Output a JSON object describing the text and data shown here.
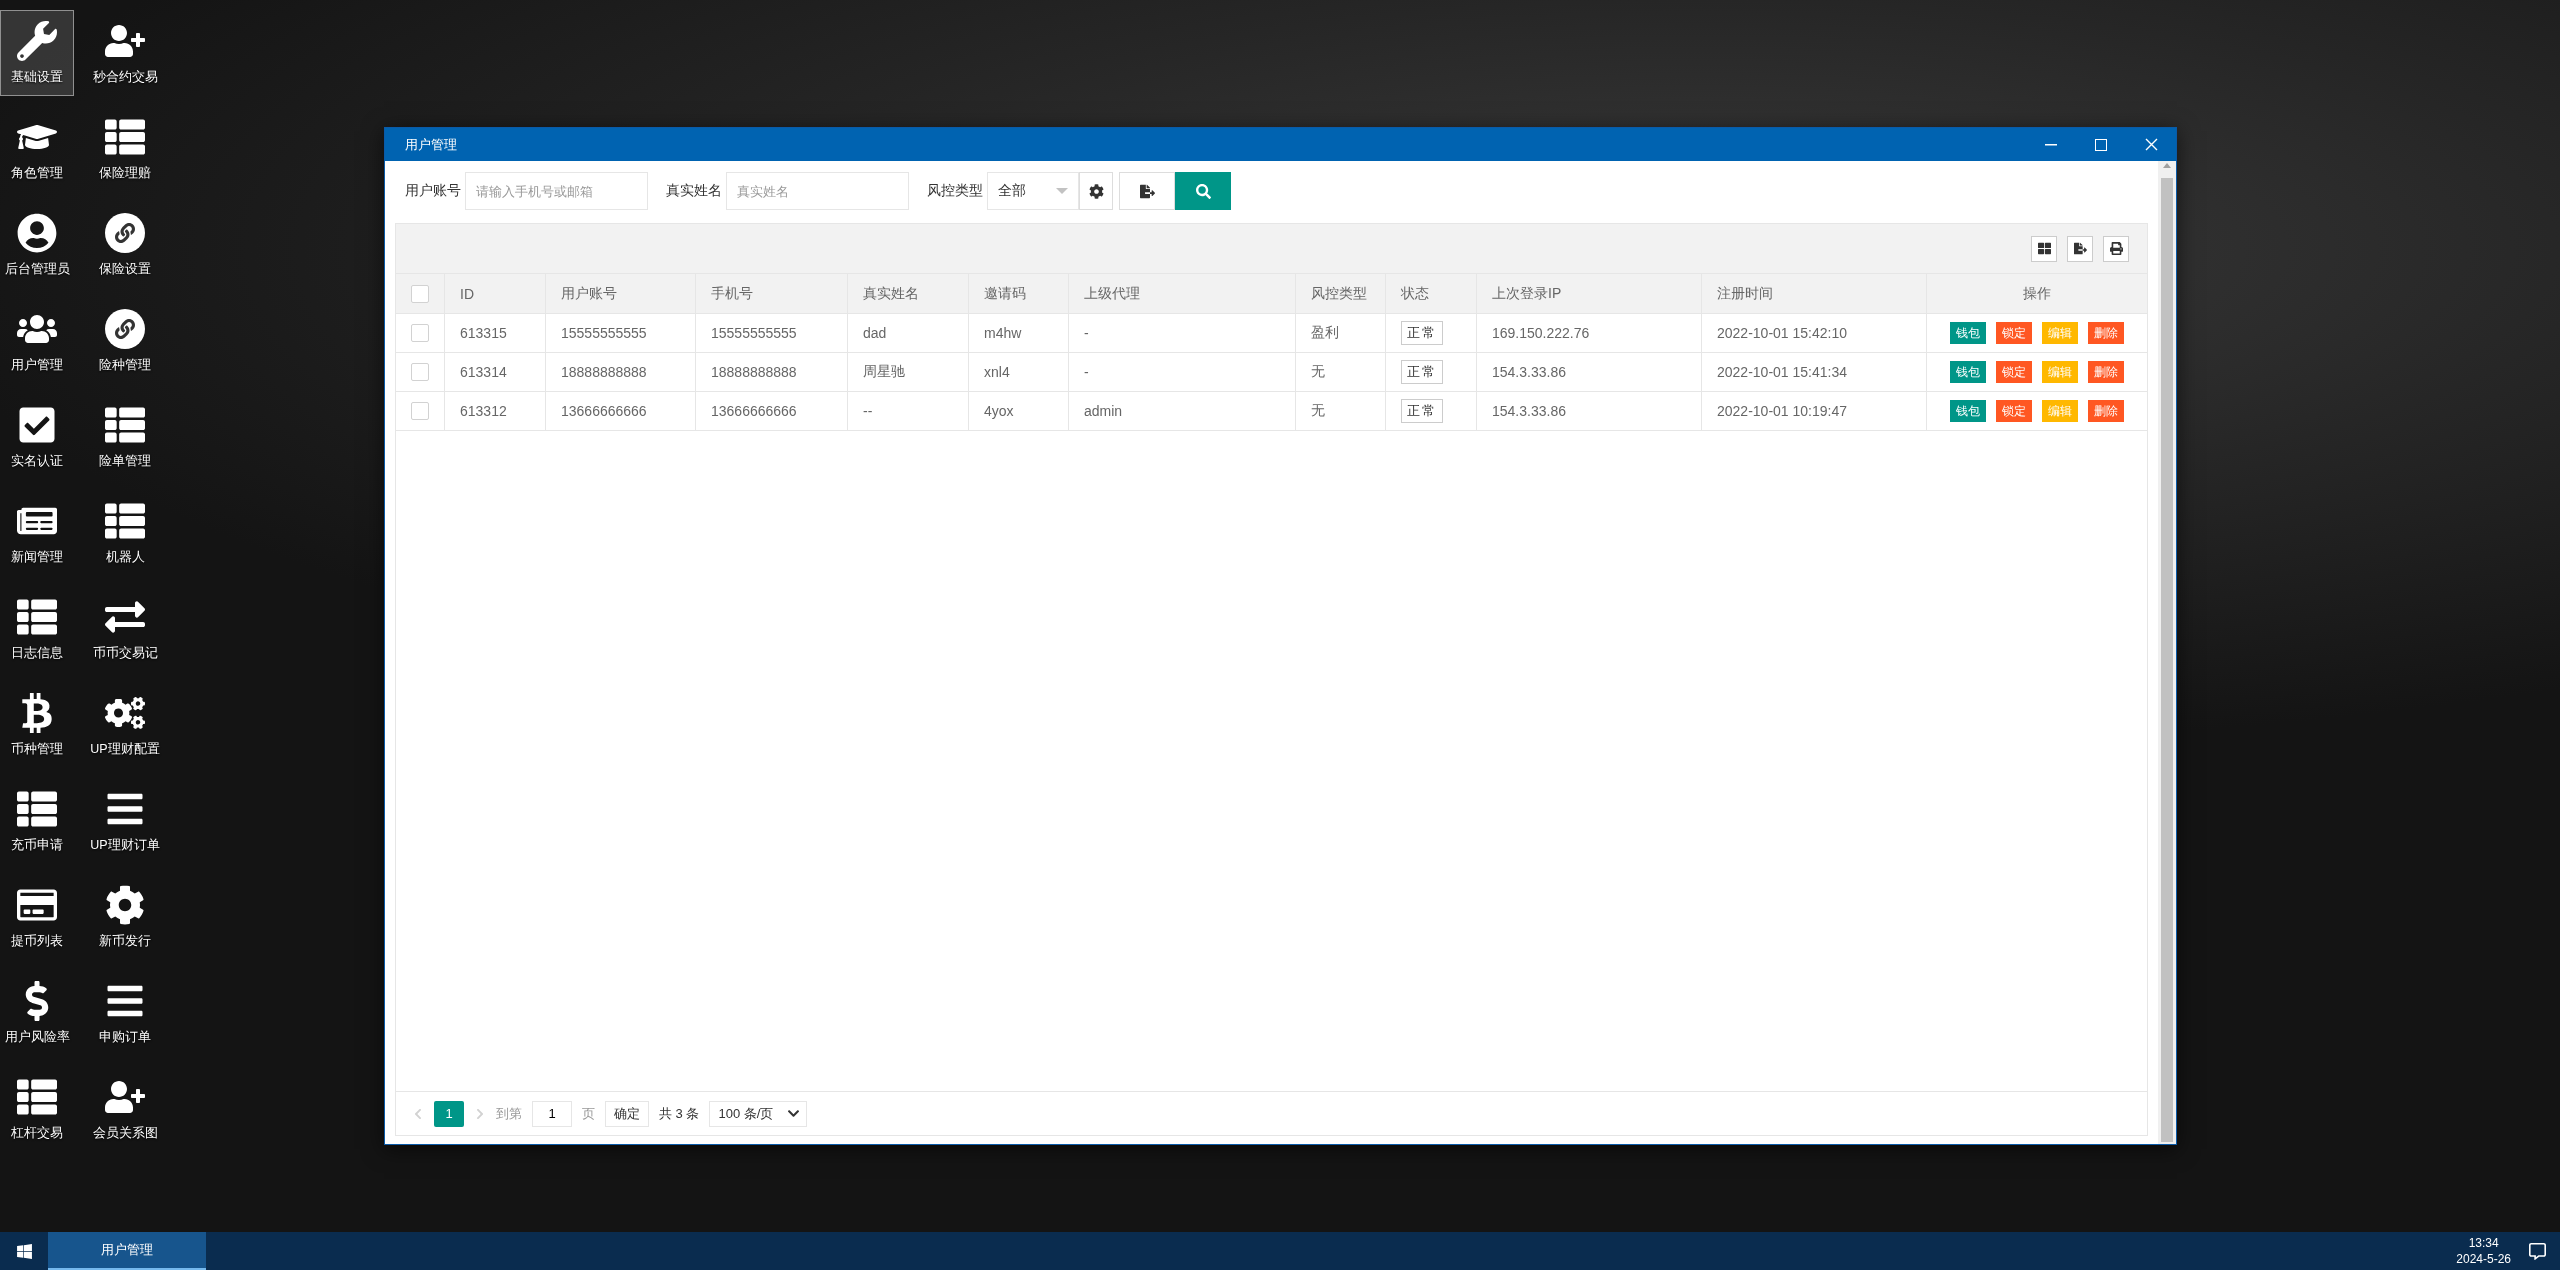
{
  "desktop_icons": [
    {
      "label": "基础设置",
      "selected": true
    },
    {
      "label": "秒合约交易",
      "selected": false
    },
    {
      "label": "角色管理",
      "selected": false
    },
    {
      "label": "保险理赔",
      "selected": false
    },
    {
      "label": "后台管理员",
      "selected": false
    },
    {
      "label": "保险设置",
      "selected": false
    },
    {
      "label": "用户管理",
      "selected": false
    },
    {
      "label": "险种管理",
      "selected": false
    },
    {
      "label": "实名认证",
      "selected": false
    },
    {
      "label": "险单管理",
      "selected": false
    },
    {
      "label": "新闻管理",
      "selected": false
    },
    {
      "label": "机器人",
      "selected": false
    },
    {
      "label": "日志信息",
      "selected": false
    },
    {
      "label": "币币交易记",
      "selected": false
    },
    {
      "label": "币种管理",
      "selected": false
    },
    {
      "label": "UP理财配置",
      "selected": false
    },
    {
      "label": "充币申请",
      "selected": false
    },
    {
      "label": "UP理财订单",
      "selected": false
    },
    {
      "label": "提币列表",
      "selected": false
    },
    {
      "label": "新币发行",
      "selected": false
    },
    {
      "label": "用户风险率",
      "selected": false
    },
    {
      "label": "申购订单",
      "selected": false
    },
    {
      "label": "杠杆交易",
      "selected": false
    },
    {
      "label": "会员关系图",
      "selected": false
    }
  ],
  "window": {
    "title": "用户管理"
  },
  "filters": [
    {
      "label": "用户账号",
      "placeholder": "请输入手机号或邮箱"
    },
    {
      "label": "真实姓名",
      "placeholder": "真实姓名"
    }
  ],
  "risk_select": {
    "label": "风控类型",
    "value": "全部"
  },
  "table": {
    "all_checked": false,
    "columns": [
      "ID",
      "用户账号",
      "手机号",
      "真实姓名",
      "邀请码",
      "上级代理",
      "风控类型",
      "状态",
      "上次登录IP",
      "注册时间",
      "操作"
    ],
    "rows": [
      {
        "checked": false,
        "cells": [
          "613315",
          "15555555555",
          "15555555555",
          "dad",
          "m4hw",
          "-",
          "盈利"
        ],
        "status": "正常",
        "ip": "169.150.222.76",
        "time": "2022-10-01 15:42:10",
        "actions": [
          {
            "label": "钱包",
            "color": "#009688"
          },
          {
            "label": "锁定",
            "color": "#ff5722"
          },
          {
            "label": "编辑",
            "color": "#ffb800"
          },
          {
            "label": "删除",
            "color": "#ff5722"
          }
        ]
      },
      {
        "checked": false,
        "cells": [
          "613314",
          "18888888888",
          "18888888888",
          "周星驰",
          "xnl4",
          "-",
          "无"
        ],
        "status": "正常",
        "ip": "154.3.33.86",
        "time": "2022-10-01 15:41:34",
        "actions": [
          {
            "label": "钱包",
            "color": "#009688"
          },
          {
            "label": "锁定",
            "color": "#ff5722"
          },
          {
            "label": "编辑",
            "color": "#ffb800"
          },
          {
            "label": "删除",
            "color": "#ff5722"
          }
        ]
      },
      {
        "checked": false,
        "cells": [
          "613312",
          "13666666666",
          "13666666666",
          "--",
          "4yox",
          "admin",
          "无"
        ],
        "status": "正常",
        "ip": "154.3.33.86",
        "time": "2022-10-01 10:19:47",
        "actions": [
          {
            "label": "钱包",
            "color": "#009688"
          },
          {
            "label": "锁定",
            "color": "#ff5722"
          },
          {
            "label": "编辑",
            "color": "#ffb800"
          },
          {
            "label": "删除",
            "color": "#ff5722"
          }
        ]
      }
    ]
  },
  "pagination": {
    "pages": [
      {
        "label": "1",
        "selected": true
      }
    ],
    "goto_label": "到第",
    "goto_value": "1",
    "page_unit": "页",
    "confirm": "确定",
    "total": "共 3 条",
    "page_size": "100 条/页"
  },
  "taskbar": {
    "tasks": [
      {
        "label": "用户管理",
        "selected": true
      }
    ],
    "time": "13:34",
    "date": "2024-5-26"
  }
}
